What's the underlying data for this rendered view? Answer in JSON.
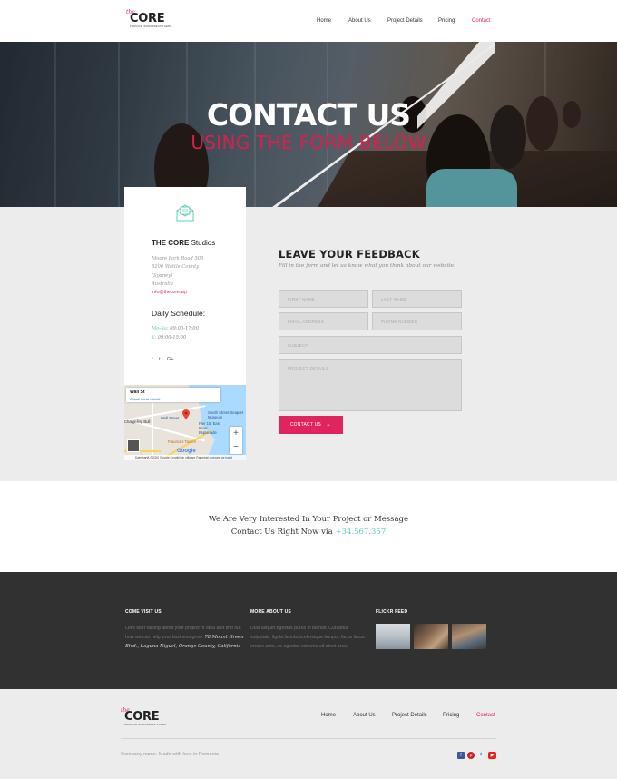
{
  "header": {
    "logo": {
      "the": "the",
      "word": "CORE",
      "tagline": "PREMIUM WORDPRESS THEME"
    },
    "nav": [
      "Home",
      "About Us",
      "Project Details",
      "Pricing",
      "Contact"
    ]
  },
  "hero": {
    "title": "CONTACT US",
    "subtitle": "USING THE FORM BELOW"
  },
  "card": {
    "icon": "envelope-icon",
    "studio_bold": "THE CORE",
    "studio_rest": " Studios",
    "address": [
      "Moore Park Road 503",
      "8200 Wattle County",
      "(Sydney)",
      "Australia"
    ],
    "email": "info@thecore.wp",
    "schedule_title": "Daily Schedule:",
    "hours": [
      {
        "days": "Mo-Sa:",
        "time": " 09:00-17:00"
      },
      {
        "days": "V:",
        "time": " 09:00-15:00"
      }
    ],
    "social": [
      "f",
      "t",
      "G+"
    ]
  },
  "map": {
    "place": "Wall St",
    "link": "Afișați harta mărită",
    "labels": [
      "Wall Street",
      "South Street Seaport Museum",
      "Pier 15, East River Esplanade",
      "Fraunces Tavern",
      "Chargeling Bull"
    ],
    "footer": "Date hartă ©2020 Google    Condiții de utilizare    Raportați o eroare pe hartă",
    "google": "Google"
  },
  "feedback": {
    "title": "LEAVE YOUR FEEDBACK",
    "subtitle": "Fill in the form and let us know what you think about our website.",
    "fields": {
      "first_name": "FIRST NAME",
      "last_name": "LAST NAME",
      "email": "EMAIL ADDRESS",
      "phone": "PHONE NUMBER",
      "subject": "SUBJECT",
      "details": "PROJECT DETAILS"
    },
    "button": "CONTACT US",
    "button_icon": "→"
  },
  "interest": {
    "line1": "We Are Very Interested In Your Project or Message",
    "line2_pre": "Contact Us Right Now via ",
    "phone": "+34.567.357"
  },
  "dark_footer": {
    "col1_title": "COME VISIT US",
    "col1_lines": [
      "Let's start talking about your project or idea and find out",
      "how we can help your business grow. "
    ],
    "col1_addr1": "78 Mount Green",
    "col1_addr2": "Blvd., Laguna Niguel, Orange County, California",
    "col2_title": "MORE ABOUT US",
    "col2_lines": [
      "Duis aliquet egestas purus in blandit. Curabitur",
      "vulputate, ligula lacinia scelerisque tempor, lacus lacus",
      "ornare ante, ac egestas est urna sit amet arcu."
    ],
    "col3_title": "FLICKR FEED"
  },
  "footer": {
    "nav": [
      "Home",
      "About Us",
      "Project Details",
      "Pricing",
      "Contact"
    ],
    "copyright": "Company name. Made with love in Romania",
    "social_icons": [
      "facebook-icon",
      "pinterest-icon",
      "twitter-icon",
      "youtube-icon"
    ]
  },
  "colors": {
    "accent": "#e0245e",
    "teal": "#5ccfb8",
    "dark": "#313131",
    "light": "#ececec"
  }
}
